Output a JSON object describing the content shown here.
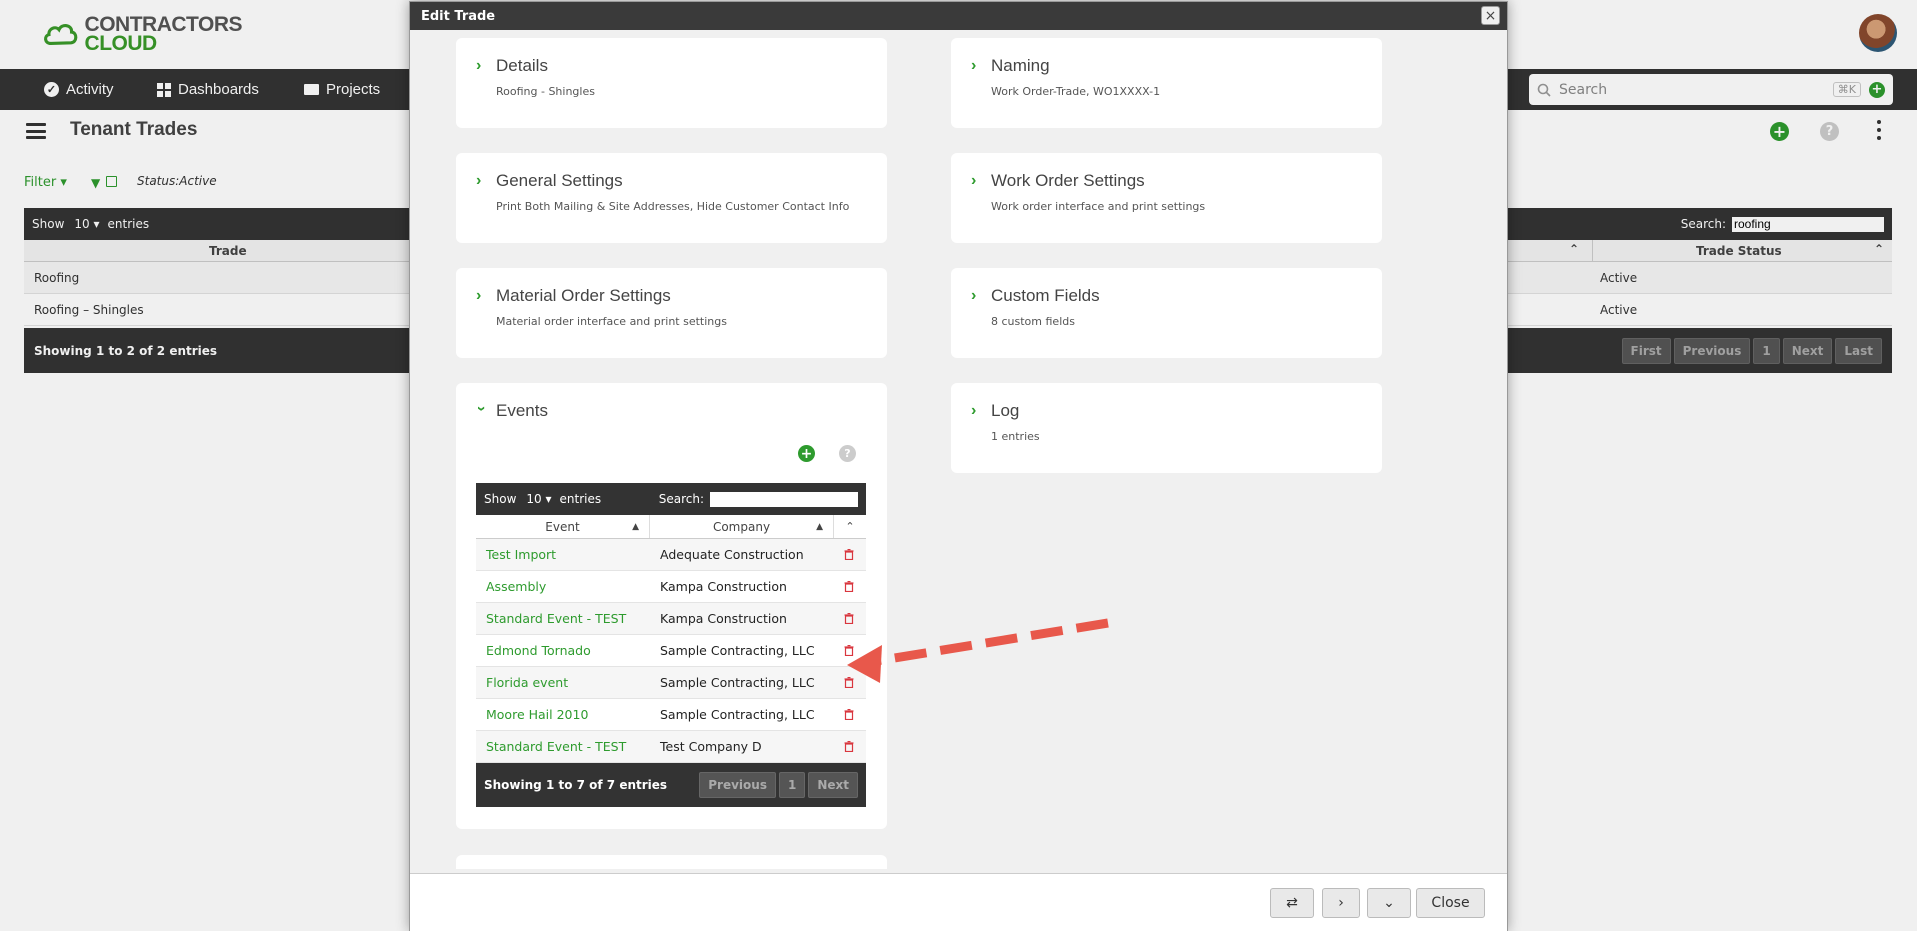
{
  "brand": {
    "line1": "CONTRACTORS",
    "line2": "CLOUD"
  },
  "nav": {
    "items": [
      {
        "label": "Activity"
      },
      {
        "label": "Dashboards"
      },
      {
        "label": "Projects"
      }
    ],
    "search_placeholder": "Search",
    "search_shortcut": "⌘K"
  },
  "page": {
    "title": "Tenant Trades",
    "filter_label": "Filter",
    "status_filter": "Status:Active"
  },
  "trades_table": {
    "show_label": "Show",
    "show_value": "10",
    "entries_label": "entries",
    "search_label": "Search:",
    "search_value": "roofing",
    "columns": [
      "Trade",
      "Trade Status"
    ],
    "rows": [
      {
        "trade": "Roofing",
        "status": "Active"
      },
      {
        "trade": "Roofing – Shingles",
        "status": "Active"
      }
    ],
    "info": "Showing 1 to 2 of 2 entries",
    "pager": [
      "First",
      "Previous",
      "1",
      "Next",
      "Last"
    ]
  },
  "modal": {
    "title": "Edit Trade",
    "sections": {
      "details": {
        "title": "Details",
        "subtitle": "Roofing - Shingles"
      },
      "naming": {
        "title": "Naming",
        "subtitle": "Work Order-Trade, WO1XXXX-1"
      },
      "general": {
        "title": "General Settings",
        "subtitle": "Print Both Mailing & Site Addresses, Hide Customer Contact Info"
      },
      "work_order": {
        "title": "Work Order Settings",
        "subtitle": "Work order interface and print settings"
      },
      "material_order": {
        "title": "Material Order Settings",
        "subtitle": "Material order interface and print settings"
      },
      "custom_fields": {
        "title": "Custom Fields",
        "subtitle": "8 custom fields"
      },
      "events": {
        "title": "Events"
      },
      "log": {
        "title": "Log",
        "subtitle": "1 entries"
      }
    },
    "events_table": {
      "show_label": "Show",
      "show_value": "10",
      "entries_label": "entries",
      "search_label": "Search:",
      "columns": [
        "Event",
        "Company"
      ],
      "rows": [
        {
          "event": "Test Import",
          "company": "Adequate Construction"
        },
        {
          "event": "Assembly",
          "company": "Kampa Construction"
        },
        {
          "event": "Standard Event - TEST",
          "company": "Kampa Construction"
        },
        {
          "event": "Edmond Tornado",
          "company": "Sample Contracting, LLC"
        },
        {
          "event": "Florida event",
          "company": "Sample Contracting, LLC"
        },
        {
          "event": "Moore Hail 2010",
          "company": "Sample Contracting, LLC"
        },
        {
          "event": "Standard Event - TEST",
          "company": "Test Company D"
        }
      ],
      "info": "Showing 1 to 7 of 7 entries",
      "pager": [
        "Previous",
        "1",
        "Next"
      ]
    },
    "footer": {
      "close_label": "Close"
    }
  },
  "colors": {
    "accent_green": "#2e9b2e",
    "dark_bar": "#333333",
    "annotation_red": "#e8584b",
    "trash_red": "#d9363e"
  }
}
